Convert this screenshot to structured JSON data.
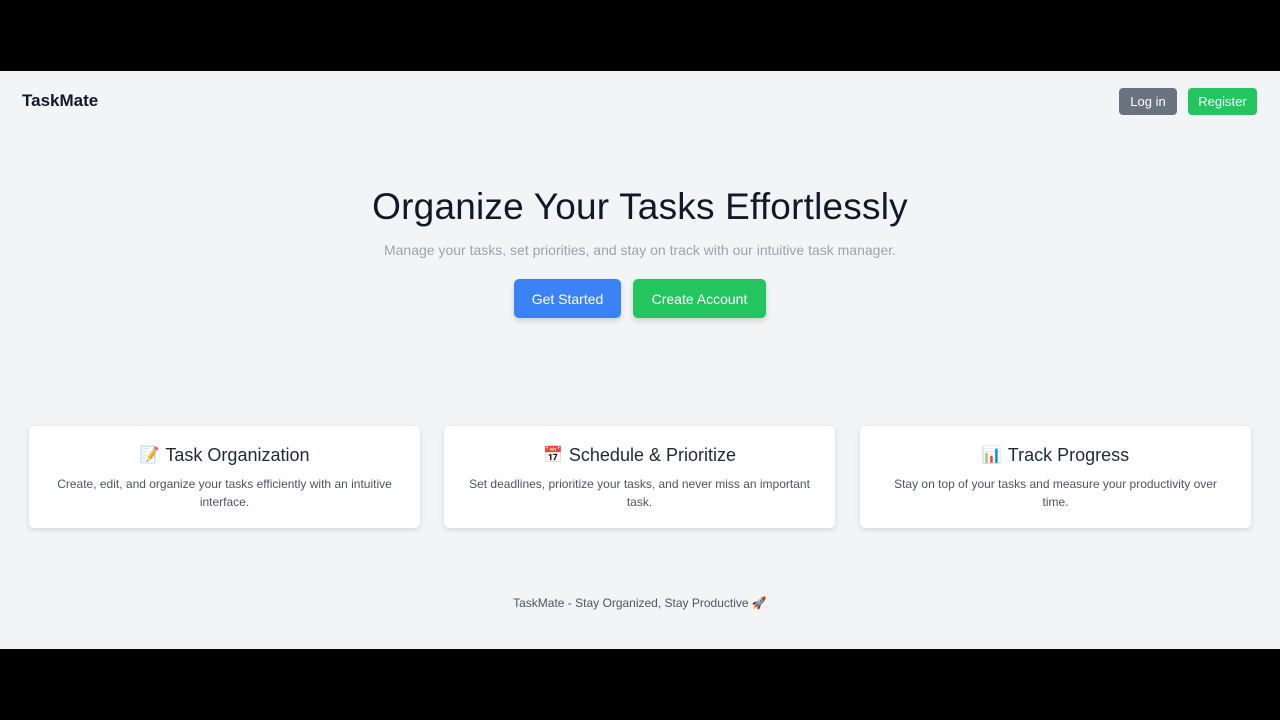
{
  "header": {
    "brand": "TaskMate",
    "login_label": "Log in",
    "register_label": "Register"
  },
  "hero": {
    "title": "Organize Your Tasks Effortlessly",
    "subtitle": "Manage your tasks, set priorities, and stay on track with our intuitive task manager.",
    "get_started_label": "Get Started",
    "create_account_label": "Create Account"
  },
  "features": [
    {
      "icon": "memo-icon",
      "icon_glyph": "📝",
      "title": "Task Organization",
      "description": "Create, edit, and organize your tasks efficiently with an intuitive interface."
    },
    {
      "icon": "calendar-icon",
      "icon_glyph": "📅",
      "title": "Schedule & Prioritize",
      "description": "Set deadlines, prioritize your tasks, and never miss an important task."
    },
    {
      "icon": "bar-chart-icon",
      "icon_glyph": "📊",
      "title": "Track Progress",
      "description": "Stay on top of your tasks and measure your productivity over time."
    }
  ],
  "footer": {
    "text": "TaskMate - Stay Organized, Stay Productive",
    "icon": "rocket-icon",
    "icon_glyph": "🚀"
  },
  "colors": {
    "background": "#f3f4f6",
    "primary_blue": "#3b82f6",
    "accent_green": "#22c55e",
    "neutral_gray": "#6b7280"
  }
}
